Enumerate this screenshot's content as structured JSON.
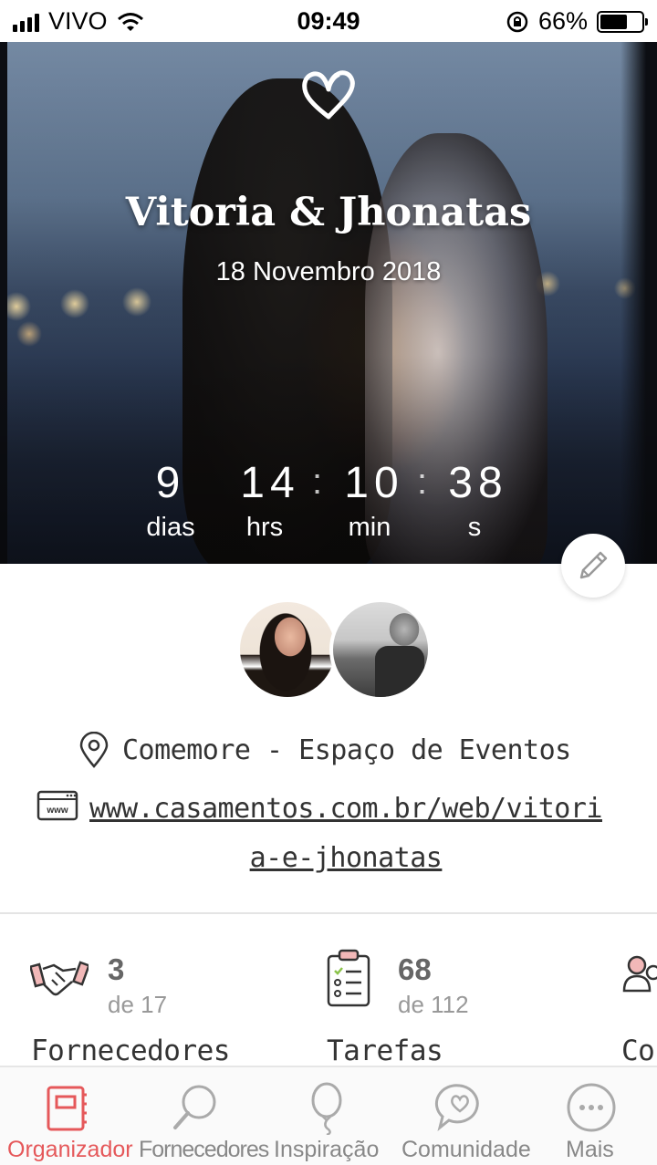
{
  "status_bar": {
    "carrier": "VIVO",
    "time": "09:49",
    "battery": "66%",
    "battery_level": 0.66
  },
  "hero": {
    "couple_name": "Vitoria & Jhonatas",
    "date": "18 Novembro 2018",
    "countdown": {
      "days": "9",
      "hours": "14",
      "minutes": "10",
      "seconds": "38",
      "days_label": "dias",
      "hours_label": "hrs",
      "minutes_label": "min",
      "seconds_label": "s",
      "separator": ":"
    }
  },
  "venue": "Comemore - Espaço de Eventos",
  "website": "www.casamentos.com.br/web/vitoria-e-jhonatas",
  "stats": [
    {
      "icon": "handshake-icon",
      "count": "3",
      "total": "de 17",
      "label": "Fornecedores"
    },
    {
      "icon": "clipboard-checklist-icon",
      "count": "68",
      "total": "de 112",
      "label": "Tarefas"
    },
    {
      "icon": "guests-icon",
      "label": "Co"
    }
  ],
  "nav": [
    {
      "label": "Organizador",
      "icon": "notebook-icon",
      "active": true
    },
    {
      "label": "Fornecedores",
      "icon": "magnifier-icon",
      "active": false
    },
    {
      "label": "Inspiração",
      "icon": "balloon-icon",
      "active": false
    },
    {
      "label": "Comunidade",
      "icon": "chat-heart-icon",
      "active": false
    },
    {
      "label": "Mais",
      "icon": "more-icon",
      "active": false
    }
  ],
  "colors": {
    "accent": "#e5585a",
    "text": "#333333",
    "muted": "#999999"
  }
}
